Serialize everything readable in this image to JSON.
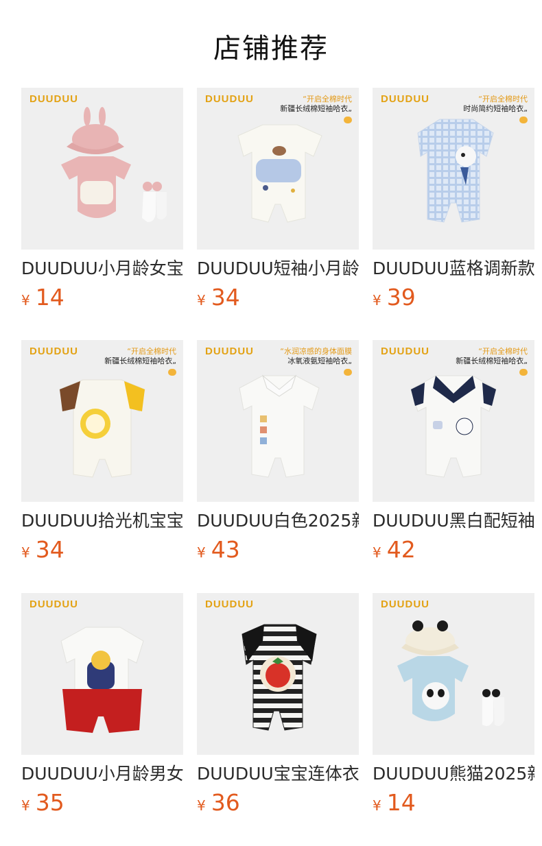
{
  "header": {
    "title": "店铺推荐"
  },
  "colors": {
    "price": "#e25a1e",
    "brand": "#e3a214",
    "thumb_bg": "#efefef"
  },
  "products": [
    {
      "brand": "DUUDUU",
      "name": "DUUDUU小月龄女宝",
      "currency": "¥",
      "price": "14",
      "slogan": "",
      "subtitle": "",
      "garment": "pink-bunny-romper"
    },
    {
      "brand": "DUUDUU",
      "name": "DUUDUU短袖小月龄",
      "currency": "¥",
      "price": "34",
      "slogan": "“开启全棉时代",
      "subtitle": "新疆长绒棉短袖哈衣„",
      "garment": "white-hug-romper"
    },
    {
      "brand": "DUUDUU",
      "name": "DUUDUU蓝格调新款",
      "currency": "¥",
      "price": "39",
      "slogan": "“开启全棉时代",
      "subtitle": "时尚简约短袖哈衣„",
      "garment": "blue-plaid-romper"
    },
    {
      "brand": "DUUDUU",
      "name": "DUUDUU拾光机宝宝",
      "currency": "¥",
      "price": "34",
      "slogan": "“开启全棉时代",
      "subtitle": "新疆长绒棉短袖哈衣„",
      "garment": "clock-romper"
    },
    {
      "brand": "DUUDUU",
      "name": "DUUDUU白色2025新",
      "currency": "¥",
      "price": "43",
      "slogan": "“水润凉感的身体面膜",
      "subtitle": "冰氧液氨短袖哈衣„",
      "garment": "white-collar-romper"
    },
    {
      "brand": "DUUDUU",
      "name": "DUUDUU黑白配短袖",
      "currency": "¥",
      "price": "42",
      "slogan": "“开启全棉时代",
      "subtitle": "新疆长绒棉短袖哈衣„",
      "garment": "navy-collar-romper"
    },
    {
      "brand": "DUUDUU",
      "name": "DUUDUU小月龄男女",
      "currency": "¥",
      "price": "35",
      "slogan": "",
      "subtitle": "",
      "garment": "red-love-romper"
    },
    {
      "brand": "DUUDUU",
      "name": "DUUDUU宝宝连体衣",
      "currency": "¥",
      "price": "36",
      "slogan": "",
      "subtitle": "",
      "garment": "striped-strawberry-romper"
    },
    {
      "brand": "DUUDUU",
      "name": "DUUDUU熊猫2025新",
      "currency": "¥",
      "price": "14",
      "slogan": "",
      "subtitle": "",
      "garment": "panda-romper"
    }
  ]
}
